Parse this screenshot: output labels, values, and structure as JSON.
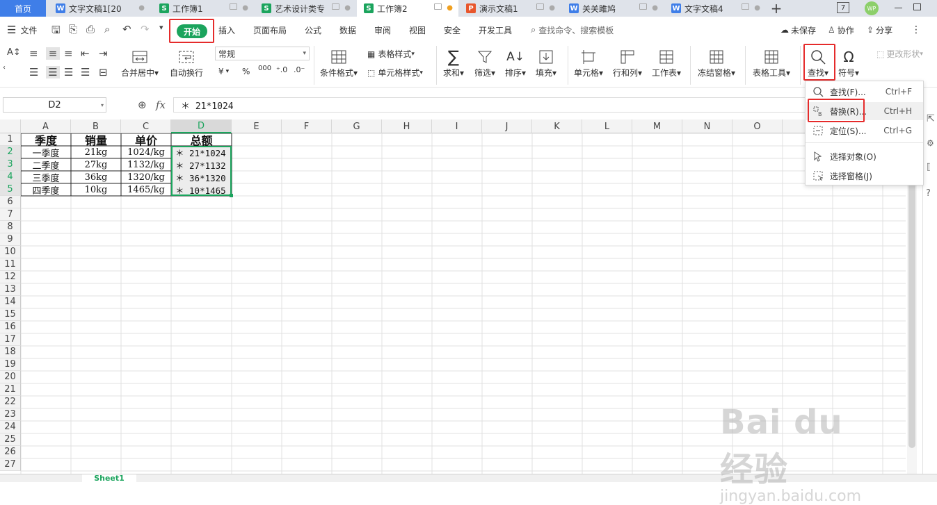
{
  "tabs": {
    "home": "首页",
    "items": [
      {
        "label": "文字文稿1[20",
        "type": "W"
      },
      {
        "label": "工作簿1",
        "type": "S"
      },
      {
        "label": "艺术设计类专",
        "type": "S"
      },
      {
        "label": "工作簿2",
        "type": "S"
      },
      {
        "label": "演示文稿1",
        "type": "P"
      },
      {
        "label": "关关雎鸠",
        "type": "W"
      },
      {
        "label": "文字文稿4",
        "type": "W"
      }
    ],
    "add": "+",
    "badge_number": "7",
    "avatar": "WP"
  },
  "menu": {
    "file": "文件",
    "items": [
      "开始",
      "插入",
      "页面布局",
      "公式",
      "数据",
      "审阅",
      "视图",
      "安全",
      "开发工具"
    ],
    "search": "查找命令、搜索模板",
    "unsaved": "未保存",
    "collab": "协作",
    "share": "分享"
  },
  "ribbon": {
    "merge": "合并居中",
    "wrap": "自动换行",
    "format_value": "常规",
    "currency": "¥",
    "percent": "%",
    "thousands": "000",
    "cond_format": "条件格式",
    "table_style": "表格样式",
    "cell_style": "单元格样式",
    "sum": "求和",
    "filter": "筛选",
    "sort": "排序",
    "fill": "填充",
    "cell": "单元格",
    "rowcol": "行和列",
    "sheet": "工作表",
    "freeze": "冻结窗格",
    "table_tools": "表格工具",
    "find": "查找",
    "symbol": "符号",
    "change_shape": "更改形状"
  },
  "formula_bar": {
    "name_box": "D2",
    "fx": "fx",
    "formula": "＊ 21*1024"
  },
  "sheet": {
    "columns": [
      "A",
      "B",
      "C",
      "D",
      "E",
      "F",
      "G",
      "H",
      "I",
      "J",
      "K",
      "L",
      "M",
      "N",
      "O"
    ],
    "rows": [
      "1",
      "2",
      "3",
      "4",
      "5",
      "6",
      "7",
      "8",
      "9",
      "10",
      "11",
      "12",
      "13",
      "14",
      "15",
      "16",
      "17",
      "18",
      "19",
      "20",
      "21",
      "22",
      "23",
      "24",
      "25",
      "26",
      "27"
    ],
    "header": [
      "季度",
      "销量",
      "单价",
      "总额"
    ],
    "data": [
      [
        "一季度",
        "21kg",
        "1024/kg",
        "＊ 21*1024"
      ],
      [
        "二季度",
        "27kg",
        "1132/kg",
        "＊ 27*1132"
      ],
      [
        "三季度",
        "36kg",
        "1320/kg",
        "＊ 36*1320"
      ],
      [
        "四季度",
        "10kg",
        "1465/kg",
        "＊ 10*1465"
      ]
    ],
    "sheet_tab": "Sheet1"
  },
  "find_menu": {
    "items": [
      {
        "label": "查找(F)...",
        "shortcut": "Ctrl+F"
      },
      {
        "label": "替换(R)...",
        "shortcut": "Ctrl+H"
      },
      {
        "label": "定位(S)...",
        "shortcut": "Ctrl+G"
      },
      {
        "label": "选择对象(O)",
        "shortcut": ""
      },
      {
        "label": "选择窗格(J)",
        "shortcut": ""
      }
    ]
  },
  "watermark": {
    "big": "Bai du 经验",
    "small": "jingyan.baidu.com"
  },
  "colors": {
    "accent_green": "#1ba45d",
    "highlight_red": "#e52b2b",
    "home_blue": "#3f7ee8"
  }
}
